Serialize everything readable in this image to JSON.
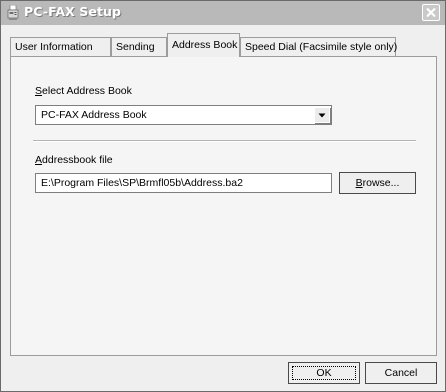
{
  "window": {
    "title": "PC-FAX Setup"
  },
  "tabs": [
    {
      "label": "User Information"
    },
    {
      "label": "Sending"
    },
    {
      "label": "Address Book"
    },
    {
      "label": "Speed Dial (Facsimile style only)"
    }
  ],
  "address_book": {
    "select_label_mnemonic": "S",
    "select_label_rest": "elect Address Book",
    "selected_book": "PC-FAX Address Book",
    "file_label_mnemonic": "A",
    "file_label_rest": "ddressbook file",
    "file_path": "E:\\Program Files\\SP\\Brmfl05b\\Address.ba2",
    "browse_mnemonic": "B",
    "browse_rest": "rowse..."
  },
  "footer": {
    "ok_label": "OK",
    "cancel_label": "Cancel"
  }
}
